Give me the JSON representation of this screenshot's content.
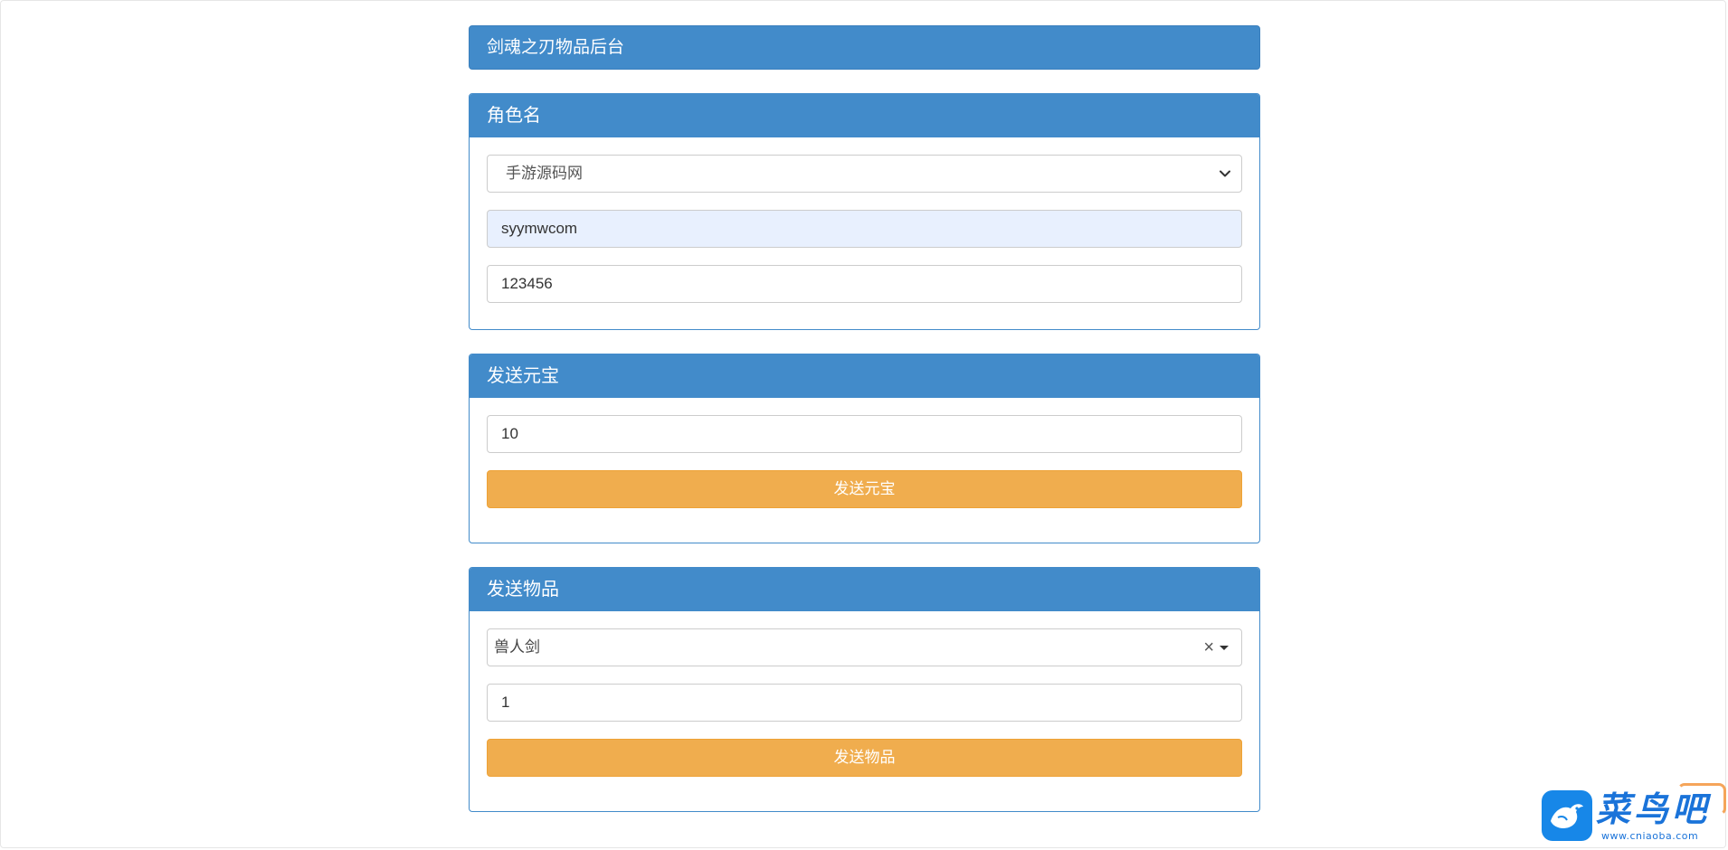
{
  "header": {
    "title": "剑魂之刃物品后台"
  },
  "role_panel": {
    "heading": "角色名",
    "server_select": {
      "selected": "手游源码网",
      "icon": "chevron-down-icon"
    },
    "account_input": {
      "value": "syymwcom"
    },
    "password_input": {
      "value": "123456"
    }
  },
  "yuanbao_panel": {
    "heading": "发送元宝",
    "amount_input": {
      "value": "10"
    },
    "send_button": "发送元宝"
  },
  "item_panel": {
    "heading": "发送物品",
    "item_select": {
      "selected": "兽人剑",
      "clear_glyph": "×",
      "icons": [
        "close-icon",
        "caret-down-icon"
      ]
    },
    "quantity_input": {
      "value": "1"
    },
    "send_button": "发送物品"
  },
  "watermark": {
    "logo_text": "菜鸟吧",
    "url": "www.cniaoba.com"
  },
  "colors": {
    "primary": "#428bca",
    "warning": "#f0ad4e",
    "autofill": "#e8f0fe",
    "watermark_blue": "#1a73d9"
  }
}
